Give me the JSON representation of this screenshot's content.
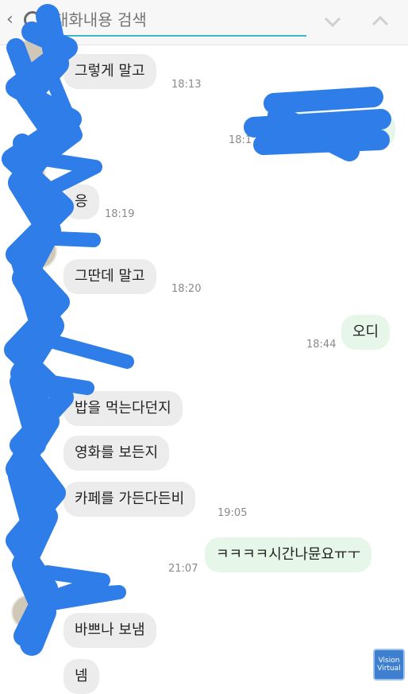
{
  "search": {
    "placeholder": "대화내용 검색"
  },
  "messages": [
    {
      "dir": "in",
      "text": "그렇게 말고",
      "time": "18:13"
    },
    {
      "dir": "out",
      "text": "?",
      "time": "18:1"
    },
    {
      "dir": "in",
      "text": "응",
      "time": "18:19"
    },
    {
      "dir": "in",
      "text": "그딴데 말고",
      "time": "18:20"
    },
    {
      "dir": "out",
      "text": "오디",
      "time": "18:44"
    },
    {
      "dir": "in",
      "text": "밥을 먹는다던지",
      "time": ""
    },
    {
      "dir": "in",
      "text": "영화를 보든지",
      "time": ""
    },
    {
      "dir": "in",
      "text": "카페를 가든다든비",
      "time": "19:05"
    },
    {
      "dir": "out",
      "text": "ㅋㅋㅋㅋ시간나뮨요ㅠㅜ",
      "time": "21:07"
    },
    {
      "dir": "in",
      "text": "바쁘나 보냄",
      "time": ""
    },
    {
      "dir": "in",
      "text": "넴",
      "time": ""
    }
  ],
  "badge": {
    "text": "Vision Virtual"
  },
  "colors": {
    "accent": "#3fb6c8",
    "redaction": "#2f7de8",
    "incoming": "#ececec",
    "outgoing": "#e6f6e9"
  }
}
